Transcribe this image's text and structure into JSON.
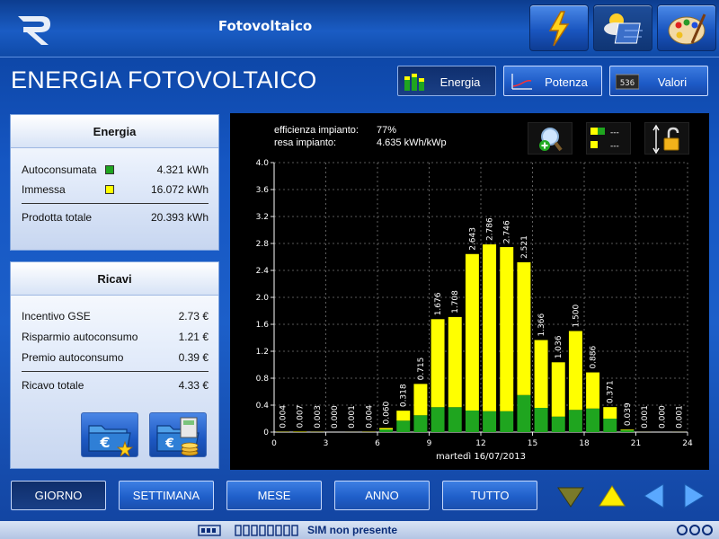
{
  "header": {
    "app_title": "Fotovoltaico",
    "nav_buttons": [
      "energy",
      "weather",
      "palette"
    ]
  },
  "page": {
    "title": "ENERGIA FOTOVOLTAICO",
    "tabs": [
      {
        "label": "Energia",
        "icon": "bar-chart-icon",
        "active": true
      },
      {
        "label": "Potenza",
        "icon": "line-chart-icon",
        "active": false
      },
      {
        "label": "Valori",
        "icon": "values-icon",
        "icon_text": "536",
        "active": false
      }
    ]
  },
  "energia_panel": {
    "title": "Energia",
    "rows": [
      {
        "label": "Autoconsumata",
        "value": "4.321 kWh",
        "color": "#1fa51f"
      },
      {
        "label": "Immessa",
        "value": "16.072 kWh",
        "color": "#ffff00"
      }
    ],
    "total": {
      "label": "Prodotta totale",
      "value": "20.393 kWh"
    }
  },
  "ricavi_panel": {
    "title": "Ricavi",
    "rows": [
      {
        "label": "Incentivo GSE",
        "value": "2.73 €"
      },
      {
        "label": "Risparmio autoconsumo",
        "value": "1.21 €"
      },
      {
        "label": "Premio autoconsumo",
        "value": "0.39 €"
      }
    ],
    "total": {
      "label": "Ricavo totale",
      "value": "4.33 €"
    }
  },
  "chart_info": {
    "efficiency_label": "efficienza impianto:",
    "efficiency_value": "77%",
    "yield_label": "resa impianto:",
    "yield_value": "4.635 kWh/kWp",
    "legend_placeholder": "---"
  },
  "chart_data": {
    "type": "bar",
    "stacked": true,
    "xlabel": "martedì 16/07/2013",
    "ylabel": "",
    "ylim": [
      0,
      4.0
    ],
    "xlim": [
      0,
      24
    ],
    "xticks": [
      0,
      3,
      6,
      9,
      12,
      15,
      18,
      21,
      24
    ],
    "yticks": [
      0,
      0.4,
      0.8,
      1.2,
      1.6,
      2.0,
      2.4,
      2.8,
      3.2,
      3.6,
      4.0
    ],
    "yticklabels": [
      "0",
      "0.4",
      "0.8",
      "1.2",
      "1.6",
      "2.0",
      "2.4",
      "2.8",
      "3.2",
      "3.6",
      "4.0"
    ],
    "grid": true,
    "categories": [
      0,
      1,
      2,
      3,
      4,
      5,
      6,
      7,
      8,
      9,
      10,
      11,
      12,
      13,
      14,
      15,
      16,
      17,
      18,
      19,
      20,
      21,
      22,
      23
    ],
    "labels": [
      "0.004",
      "0.007",
      "0.003",
      "0.000",
      "0.001",
      "0.004",
      "0.060",
      "0.318",
      "0.715",
      "1.676",
      "1.708",
      "2.643",
      "2.786",
      "2.746",
      "2.521",
      "1.366",
      "1.036",
      "1.500",
      "0.886",
      "0.371",
      "0.039",
      "0.001",
      "0.000",
      "0.001"
    ],
    "series": [
      {
        "name": "Autoconsumata",
        "color": "#1fa51f",
        "values": [
          0,
          0,
          0,
          0,
          0,
          0,
          0.04,
          0.17,
          0.25,
          0.37,
          0.37,
          0.32,
          0.31,
          0.31,
          0.55,
          0.36,
          0.23,
          0.33,
          0.35,
          0.2,
          0.03,
          0,
          0,
          0
        ]
      },
      {
        "name": "Immessa",
        "color": "#ffff00",
        "values": [
          0.004,
          0.007,
          0.003,
          0,
          0.001,
          0.004,
          0.02,
          0.148,
          0.465,
          1.306,
          1.338,
          2.323,
          2.476,
          2.436,
          1.971,
          1.006,
          0.806,
          1.17,
          0.536,
          0.171,
          0.009,
          0.001,
          0,
          0.001
        ]
      }
    ]
  },
  "periods": [
    {
      "label": "GIORNO",
      "active": true
    },
    {
      "label": "SETTIMANA",
      "active": false
    },
    {
      "label": "MESE",
      "active": false
    },
    {
      "label": "ANNO",
      "active": false
    },
    {
      "label": "TUTTO",
      "active": false
    }
  ],
  "status": {
    "sim_text": "SIM non presente"
  }
}
